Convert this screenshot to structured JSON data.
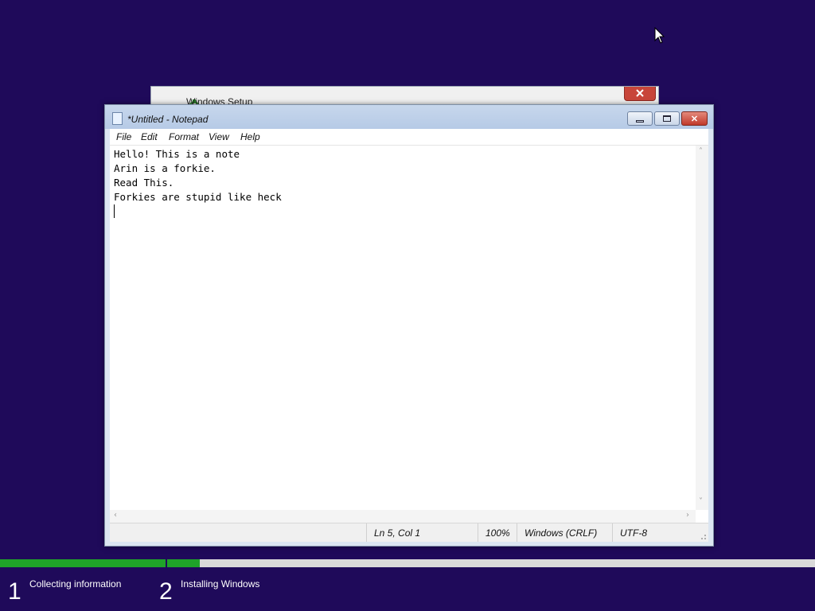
{
  "setup_window": {
    "title": "Windows Setup",
    "close_glyph": "✕"
  },
  "notepad": {
    "title": "*Untitled - Notepad",
    "window_controls": {
      "minimize": "minimize-icon",
      "maximize": "maximize-icon",
      "close": "✕"
    },
    "menu": [
      "File",
      "Edit",
      "Format",
      "View",
      "Help"
    ],
    "lines": [
      "Hello! This is a note",
      "Arin is a forkie.",
      "Read This.",
      "Forkies are stupid like heck"
    ],
    "status": {
      "position": "Ln 5, Col 1",
      "zoom": "100%",
      "line_ending": "Windows (CRLF)",
      "encoding": "UTF-8"
    },
    "scroll_glyphs": {
      "up": "˄",
      "down": "˅",
      "left": "‹",
      "right": "›"
    }
  },
  "setup_progress": {
    "steps": [
      {
        "number": "1",
        "label": "Collecting information",
        "progress": 1.0
      },
      {
        "number": "2",
        "label": "Installing Windows",
        "progress": 0.05
      }
    ]
  },
  "colors": {
    "desktop_bg": "#1f0a5a",
    "progress_green": "#1fa329",
    "titlebar": "#b6cae6",
    "close_red": "#c1392b"
  }
}
